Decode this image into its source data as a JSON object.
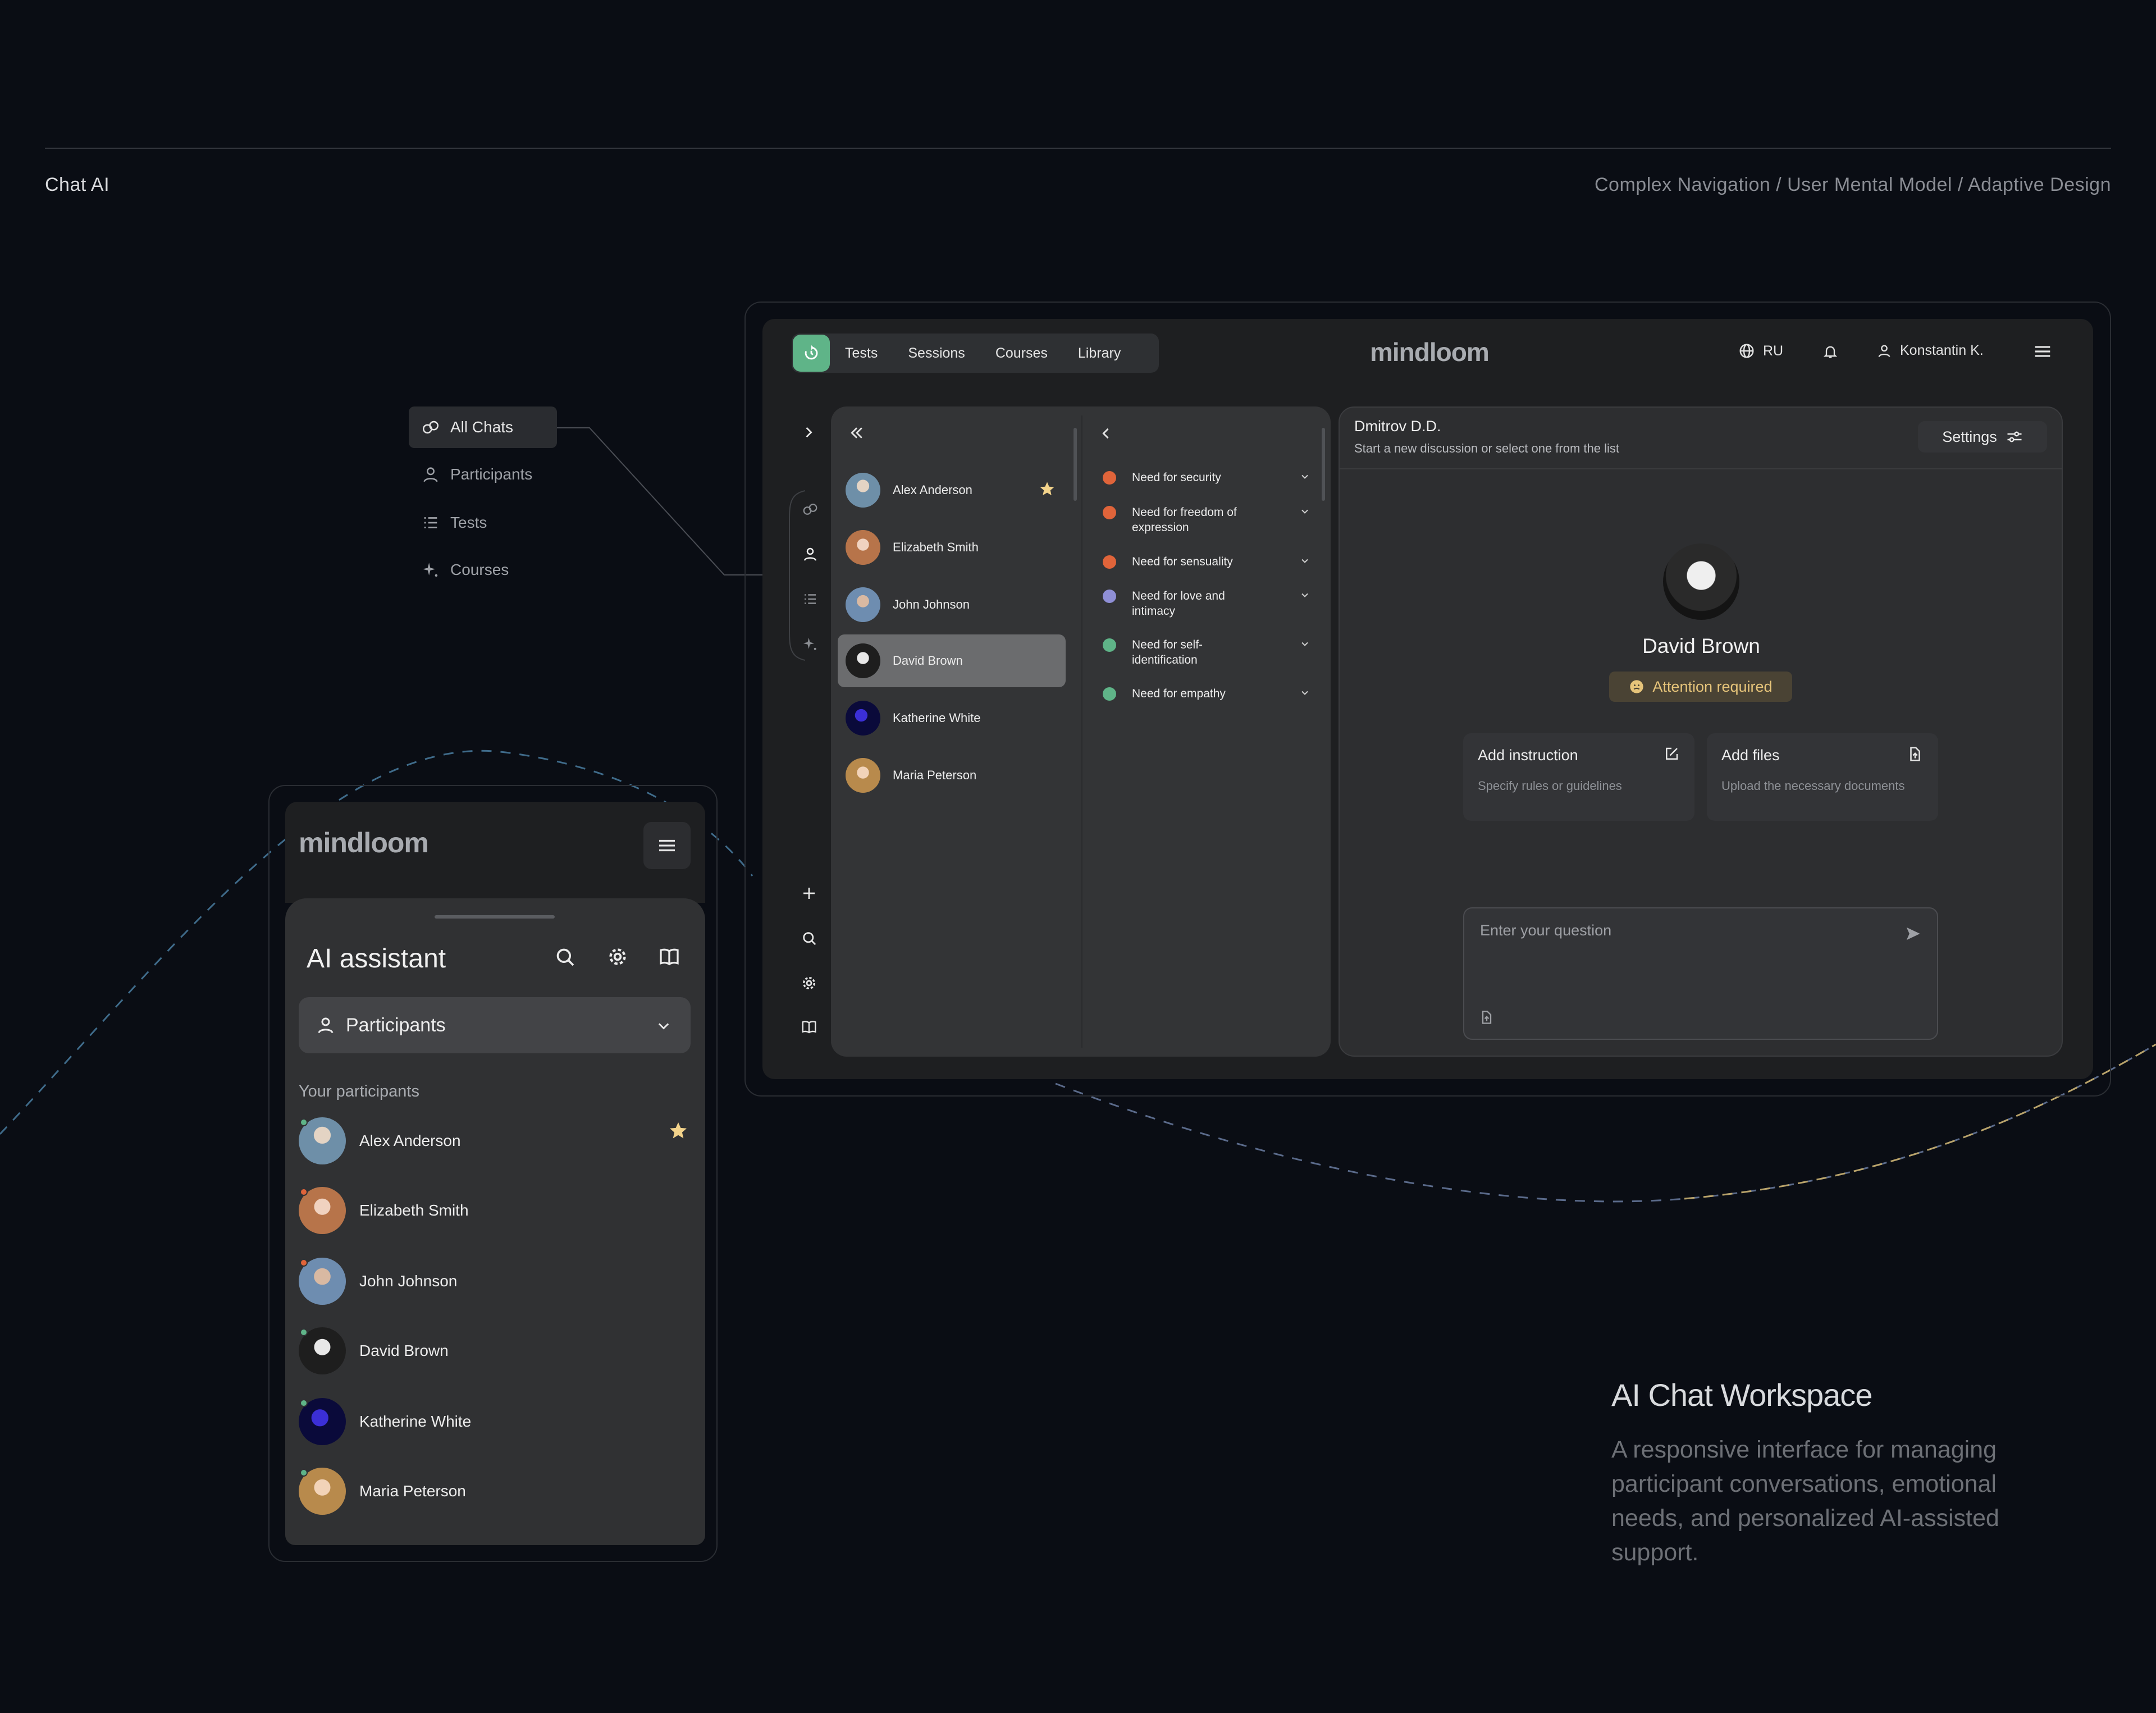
{
  "page": {
    "title": "Chat AI",
    "breadcrumb": "Complex Navigation / User Mental Model / Adaptive Design"
  },
  "floating_menu": {
    "items": [
      {
        "label": "All Chats",
        "icon": "chats-icon",
        "active": true
      },
      {
        "label": "Participants",
        "icon": "person-icon",
        "active": false
      },
      {
        "label": "Tests",
        "icon": "list-icon",
        "active": false
      },
      {
        "label": "Courses",
        "icon": "sparkle-icon",
        "active": false
      }
    ]
  },
  "desktop": {
    "nav_tabs": [
      "Tests",
      "Sessions",
      "Courses",
      "Library"
    ],
    "brand": "mindloom",
    "language": "RU",
    "user_name": "Konstantin K.",
    "participants": [
      {
        "name": "Alex Anderson",
        "starred": true,
        "active": false
      },
      {
        "name": "Elizabeth Smith",
        "starred": false,
        "active": false
      },
      {
        "name": "John Johnson",
        "starred": false,
        "active": false
      },
      {
        "name": "David Brown",
        "starred": false,
        "active": true
      },
      {
        "name": "Katherine White",
        "starred": false,
        "active": false
      },
      {
        "name": "Maria Peterson",
        "starred": false,
        "active": false
      }
    ],
    "needs": [
      {
        "line1": "Need for security",
        "line2": "",
        "status": "down",
        "color": "#e0643a"
      },
      {
        "line1": "Need for freedom of",
        "line2": "expression",
        "status": "down",
        "color": "#e0643a"
      },
      {
        "line1": "Need for sensuality",
        "line2": "",
        "status": "down",
        "color": "#e0643a"
      },
      {
        "line1": "Need for love and",
        "line2": "intimacy",
        "status": "neutral",
        "color": "#8f8fd6"
      },
      {
        "line1": "Need for self-",
        "line2": "identification",
        "status": "up",
        "color": "#5fb488"
      },
      {
        "line1": "Need for empathy",
        "line2": "",
        "status": "up",
        "color": "#5fb488"
      }
    ],
    "chat": {
      "name": "Dmitrov D.D.",
      "subtitle": "Start a new discussion or select one from the list",
      "settings_label": "Settings",
      "participant_name": "David Brown",
      "status_badge": "Attention required",
      "cards": [
        {
          "title": "Add instruction",
          "subtitle": "Specify rules or guidelines",
          "icon": "edit-icon"
        },
        {
          "title": "Add files",
          "subtitle": "Upload the necessary documents",
          "icon": "file-upload-icon"
        }
      ],
      "input_placeholder": "Enter your question"
    }
  },
  "mobile": {
    "brand": "mindloom",
    "title": "AI assistant",
    "select_value": "Participants",
    "section_label": "Your participants",
    "participants": [
      {
        "name": "Alex Anderson",
        "starred": true,
        "status_color": "#5fb488"
      },
      {
        "name": "Elizabeth Smith",
        "starred": false,
        "status_color": "#e0643a"
      },
      {
        "name": "John Johnson",
        "starred": false,
        "status_color": "#e0643a"
      },
      {
        "name": "David Brown",
        "starred": false,
        "status_color": "#5fb488"
      },
      {
        "name": "Katherine White",
        "starred": false,
        "status_color": "#5fb488"
      },
      {
        "name": "Maria Peterson",
        "starred": false,
        "status_color": "#5fb488"
      }
    ]
  },
  "caption": {
    "title": "AI Chat Workspace",
    "body": "A responsive interface for managing participant conversations, emotional needs, and personalized AI-assisted support."
  },
  "colors": {
    "background": "#0a0d14",
    "accent_green": "#5fb488",
    "warning": "#e6c47a",
    "star": "#f3d38b"
  }
}
